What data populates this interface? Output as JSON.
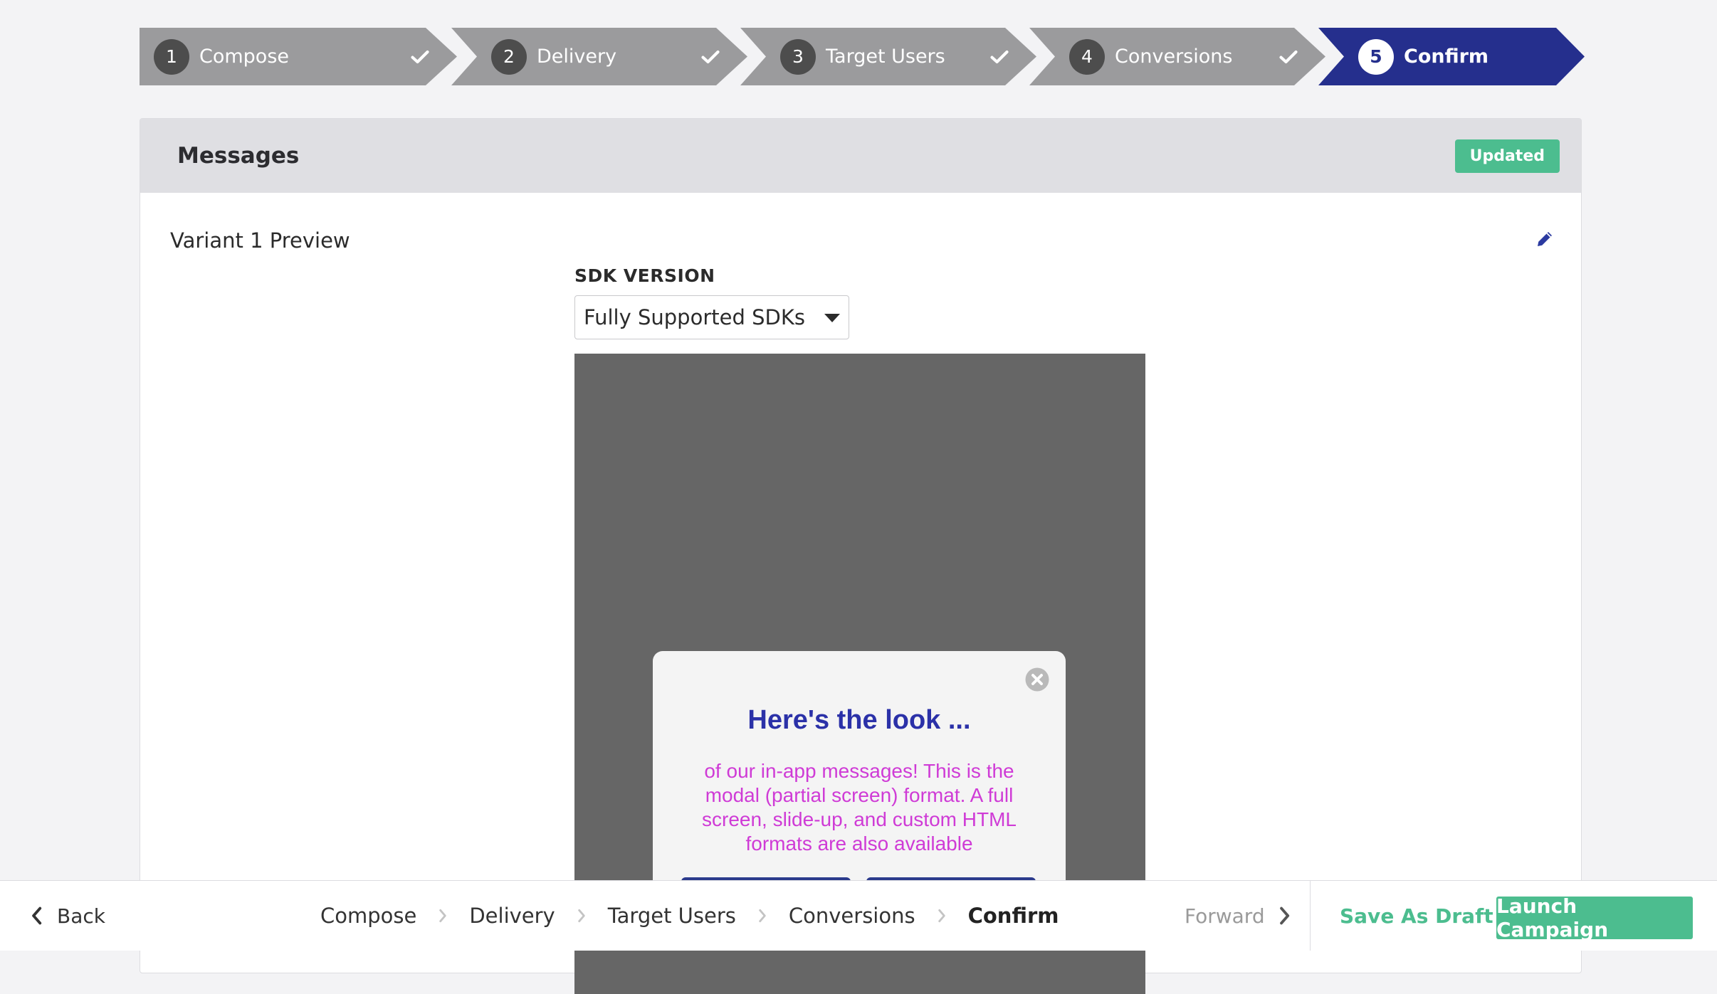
{
  "stepper": {
    "steps": [
      {
        "number": "1",
        "label": "Compose",
        "status": "done"
      },
      {
        "number": "2",
        "label": "Delivery",
        "status": "done"
      },
      {
        "number": "3",
        "label": "Target Users",
        "status": "done"
      },
      {
        "number": "4",
        "label": "Conversions",
        "status": "done"
      },
      {
        "number": "5",
        "label": "Confirm",
        "status": "active"
      }
    ]
  },
  "card": {
    "title": "Messages",
    "badge": "Updated",
    "variant_title": "Variant 1 Preview",
    "sdk_label": "SDK VERSION",
    "sdk_value": "Fully Supported SDKs"
  },
  "preview": {
    "heading": "Here's the look ...",
    "body": "of our in-app messages! This is the modal (partial screen) format. A full screen, slide-up, and custom HTML formats are also available"
  },
  "footer": {
    "back": "Back",
    "crumbs": [
      "Compose",
      "Delivery",
      "Target Users",
      "Conversions",
      "Confirm"
    ],
    "forward": "Forward",
    "save_draft": "Save As Draft",
    "launch": "Launch Campaign"
  },
  "colors": {
    "accent": "#252f8d",
    "step_done": "#9b9b9d",
    "success": "#4cbd8f",
    "modal_heading": "#2b31a8",
    "modal_body": "#cf3bd6"
  },
  "icons": [
    "check-icon",
    "pencil-icon",
    "close-circle-icon",
    "chevron-left-icon",
    "chevron-right-icon",
    "caret-down-icon"
  ]
}
